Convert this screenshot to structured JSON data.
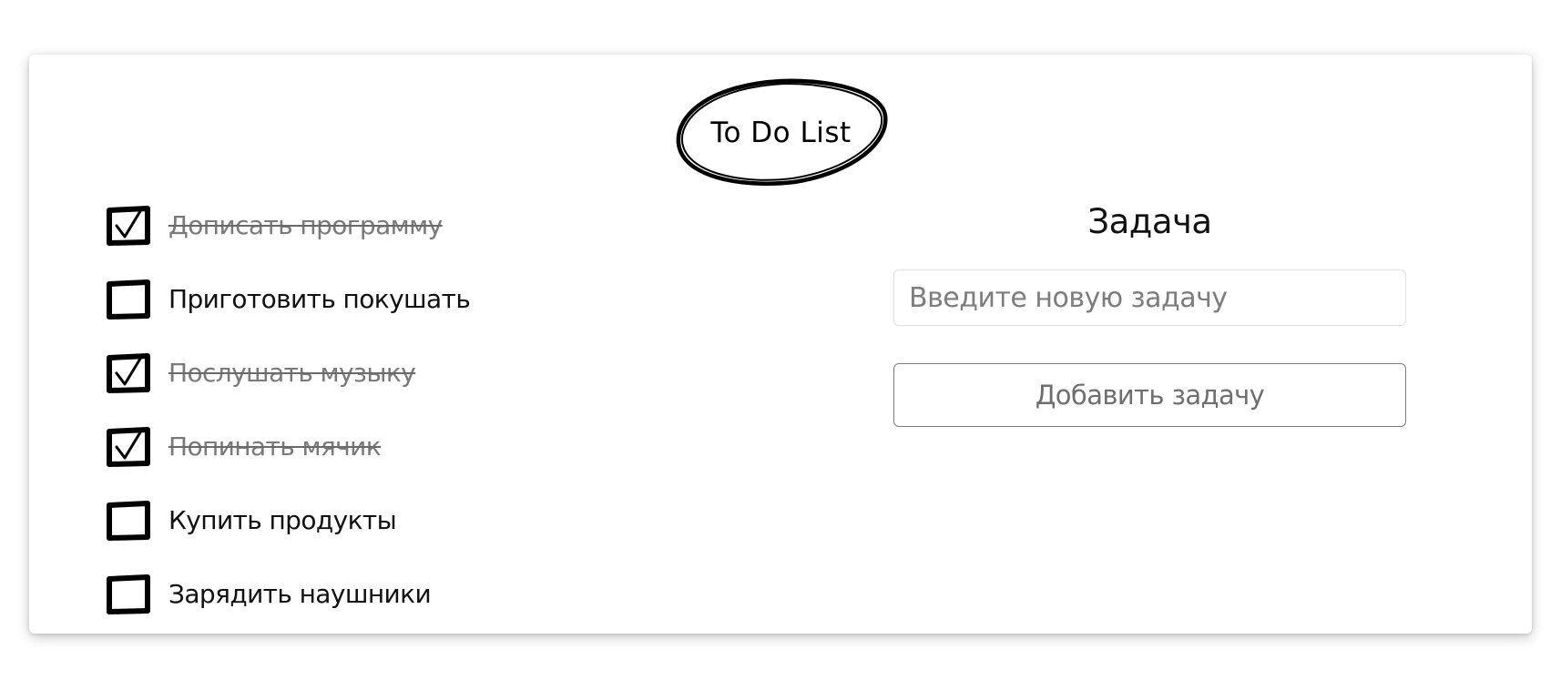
{
  "app": {
    "title": "To Do List"
  },
  "tasks": [
    {
      "label": "Дописать программу",
      "done": true
    },
    {
      "label": "Приготовить покушать",
      "done": false
    },
    {
      "label": "Послушать музыку",
      "done": true
    },
    {
      "label": "Попинать мячик",
      "done": true
    },
    {
      "label": "Купить продукты",
      "done": false
    },
    {
      "label": "Зарядить наушники",
      "done": false
    }
  ],
  "form": {
    "title": "Задача",
    "input_placeholder": "Введите новую задачу",
    "input_value": "",
    "add_button_label": "Добавить задачу"
  },
  "icons": {
    "checkbox_checked": "checkbox-checked-icon",
    "checkbox_empty": "checkbox-empty-icon",
    "title_ellipse": "hand-drawn-ellipse"
  },
  "colors": {
    "ink": "#000000",
    "done_text": "#7a7a7a",
    "button_border": "#7c7c7c",
    "input_border": "#e0e0e0"
  }
}
